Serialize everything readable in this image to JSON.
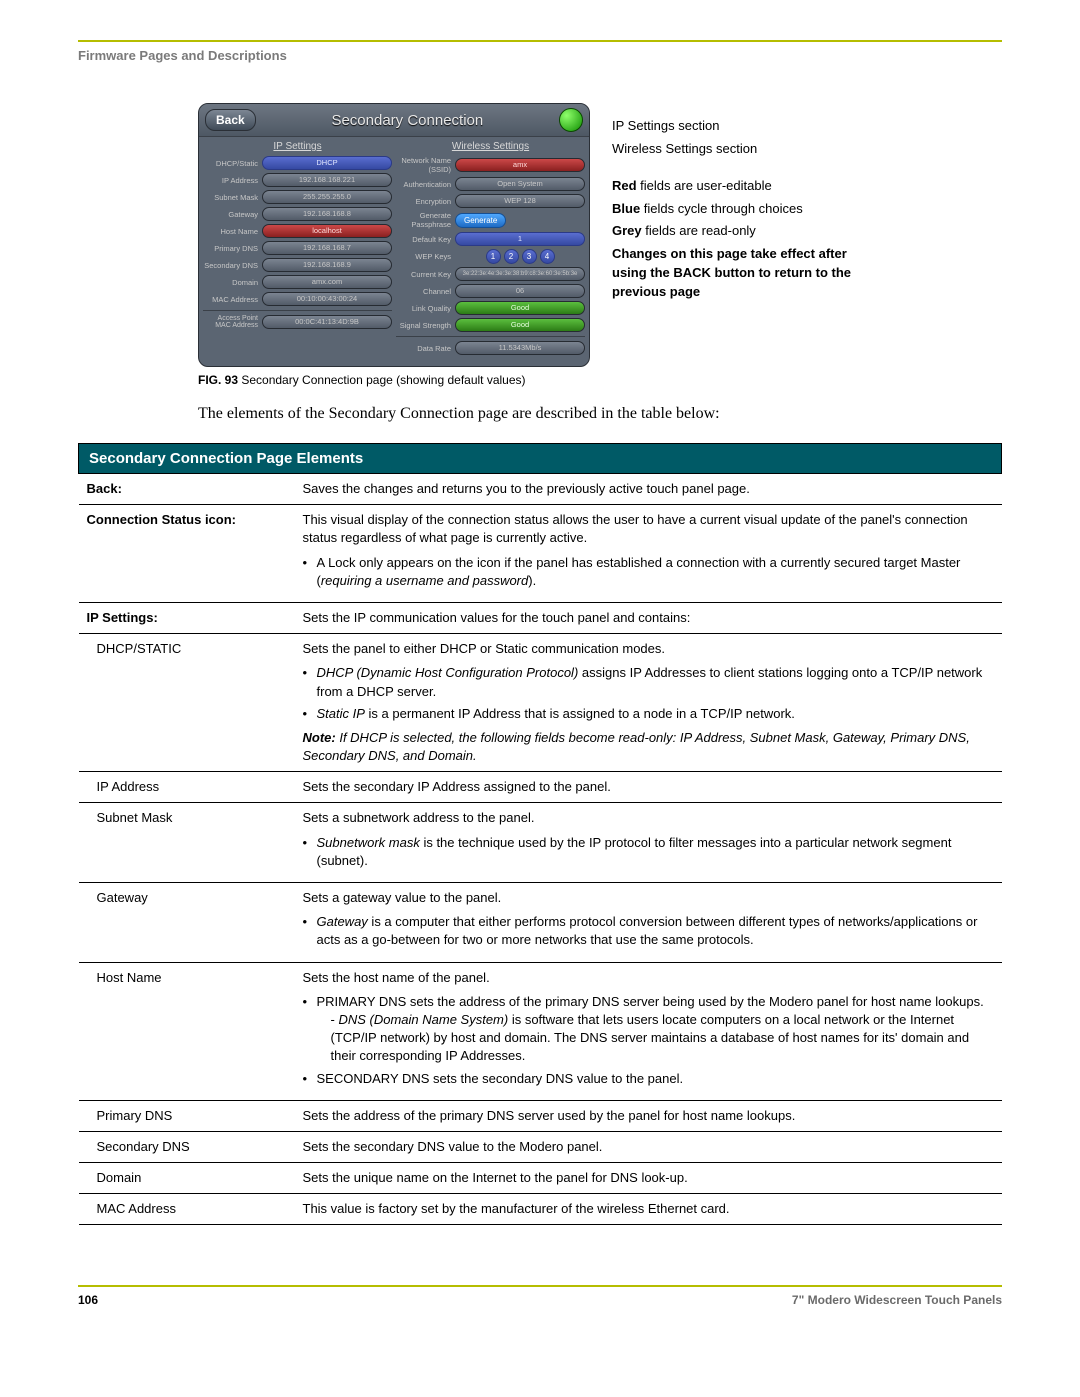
{
  "header": {
    "section": "Firmware Pages and Descriptions"
  },
  "panel": {
    "back": "Back",
    "title": "Secondary Connection",
    "ip_head": "IP Settings",
    "wl_head": "Wireless Settings",
    "ip_rows": {
      "dhcp_label": "DHCP/Static",
      "dhcp_val": "DHCP",
      "ip_label": "IP Address",
      "ip_val": "192.168.168.221",
      "sm_label": "Subnet Mask",
      "sm_val": "255.255.255.0",
      "gw_label": "Gateway",
      "gw_val": "192.168.168.8",
      "hn_label": "Host Name",
      "hn_val": "localhost",
      "pdns_label": "Primary DNS",
      "pdns_val": "192.168.168.7",
      "sdns_label": "Secondary DNS",
      "sdns_val": "192.168.168.9",
      "dom_label": "Domain",
      "dom_val": "amx.com",
      "mac_label": "MAC Address",
      "mac_val": "00:10:00:43:00:24",
      "ap_label": "Access Point MAC Address",
      "ap_val": "00:0C:41:13:4D:9B"
    },
    "wl_rows": {
      "ssid_label": "Network Name (SSID)",
      "ssid_val": "amx",
      "auth_label": "Authentication",
      "auth_val": "Open System",
      "enc_label": "Encryption",
      "enc_val": "WEP 128",
      "gen_label": "Generate Passphrase",
      "gen_btn": "Generate",
      "dkey_label": "Default Key",
      "dkey_val": "1",
      "wepk_label": "WEP Keys",
      "curk_label": "Current Key",
      "curk_val": "3e:22:3e:4e:3e:3e:38:b9:c8:3e:60:3e:5b:3e",
      "chan_label": "Channel",
      "chan_val": "06",
      "lq_label": "Link Quality",
      "lq_val": "Good",
      "ss_label": "Signal Strength",
      "ss_val": "Good",
      "dr_label": "Data Rate",
      "dr_val": "11.5343Mb/s"
    }
  },
  "callouts": {
    "c1": "IP Settings section",
    "c2": "Wireless Settings section",
    "red": "Red",
    "red_txt": " fields are user-editable",
    "blue": "Blue",
    "blue_txt": " fields cycle through choices",
    "grey": "Grey",
    "grey_txt": " fields are read-only",
    "note": "Changes on this page take effect after using the BACK button to return to the previous page"
  },
  "figcap": {
    "bold": "FIG. 93",
    "rest": "  Secondary Connection page (showing default values)"
  },
  "intro": "The elements of the Secondary Connection page are described in the table below:",
  "table": {
    "head": "Secondary Connection Page Elements",
    "rows": {
      "back_l": "Back:",
      "back_d": "Saves the changes and returns you to the previously active touch panel page.",
      "csi_l": "Connection Status icon:",
      "csi_d": "This visual display of the connection status allows the user to have a current visual update of the panel's connection status regardless of what page is currently active.",
      "csi_b1a": "A Lock only appears on the icon if the panel has established a connection with a currently secured target Master (",
      "csi_b1b": "requiring a username and password",
      "csi_b1c": ").",
      "ips_l": "IP Settings:",
      "ips_d": "Sets the IP communication values for the touch panel and contains:",
      "dhcp_l": "DHCP/STATIC",
      "dhcp_d": "Sets the panel to either DHCP or Static communication modes.",
      "dhcp_b1a": "DHCP (Dynamic Host Configuration Protocol)",
      "dhcp_b1b": " assigns IP Addresses to client stations logging onto a TCP/IP network from a DHCP server.",
      "dhcp_b2a": "Static IP",
      "dhcp_b2b": " is a permanent IP Address that is assigned to a node in a TCP/IP network.",
      "dhcp_note_b": "Note:",
      "dhcp_note": " If DHCP is selected, the following fields become read-only: IP Address, Subnet Mask, Gateway, Primary DNS, Secondary DNS, and Domain.",
      "ipa_l": "IP Address",
      "ipa_d": "Sets the secondary IP Address assigned to the panel.",
      "sm_l": "Subnet Mask",
      "sm_d": "Sets a subnetwork address to the panel.",
      "sm_b1a": "Subnetwork mask",
      "sm_b1b": " is the technique used by the IP protocol to filter messages into a particular network segment (subnet).",
      "gw_l": "Gateway",
      "gw_d": "Sets a gateway value to the panel.",
      "gw_b1a": "Gateway",
      "gw_b1b": " is a computer that either performs protocol conversion between different types of networks/applications or acts as a go-between for two or more networks that use the same protocols.",
      "hn_l": "Host Name",
      "hn_d": "Sets the host name of the panel.",
      "hn_b1": "PRIMARY DNS sets the address of the primary DNS server being used by the Modero panel for host name lookups.",
      "hn_dash_a": "DNS (Domain Name System)",
      "hn_dash_b": " is software that lets users locate computers on a local network or the Internet (TCP/IP network) by host and domain. The DNS server maintains a database of host names for its' domain and their corresponding IP Addresses.",
      "hn_b2": "SECONDARY DNS sets the secondary DNS value to the panel.",
      "pdns_l": "Primary DNS",
      "pdns_d": "Sets the address of the primary DNS server used by the panel for host name lookups.",
      "sdns_l": "Secondary DNS",
      "sdns_d": "Sets the secondary DNS value to the Modero panel.",
      "dom_l": "Domain",
      "dom_d": "Sets the unique name on the Internet to the panel for DNS look-up.",
      "mac_l": "MAC Address",
      "mac_d": "This value is factory set by the manufacturer of the wireless Ethernet card."
    }
  },
  "footer": {
    "page": "106",
    "doc": "7\" Modero Widescreen Touch Panels"
  }
}
